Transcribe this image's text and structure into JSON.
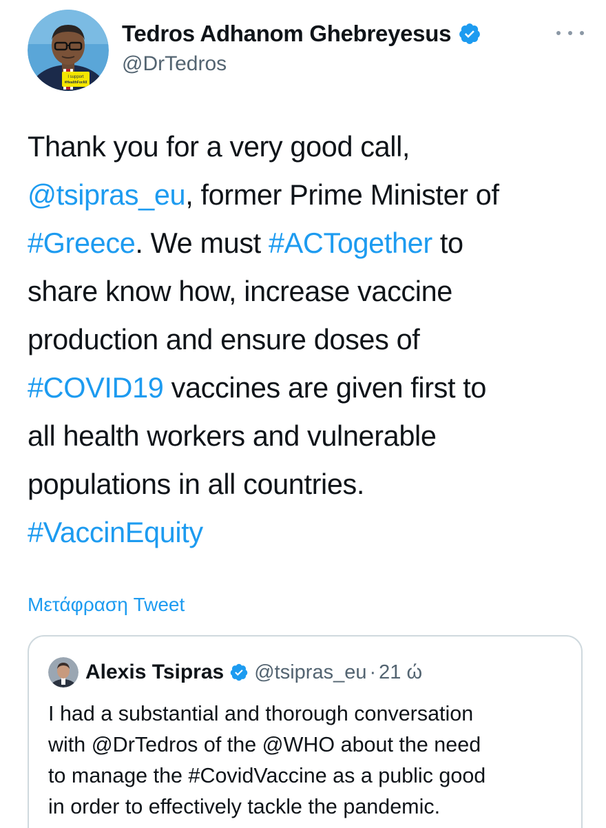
{
  "author": {
    "name": "Tedros Adhanom Ghebreyesus",
    "handle": "@DrTedros",
    "avatar_badge_line1": "I support",
    "avatar_badge_line2": "#HealthForAll"
  },
  "tweet": {
    "lines": [
      [
        {
          "text": "Thank you for a very good call,",
          "link": false
        }
      ],
      [
        {
          "text": "@tsipras_eu",
          "link": true
        },
        {
          "text": ", former Prime Minister of",
          "link": false
        }
      ],
      [
        {
          "text": "#Greece",
          "link": true
        },
        {
          "text": ". We must ",
          "link": false
        },
        {
          "text": "#ACTogether",
          "link": true
        },
        {
          "text": " to",
          "link": false
        }
      ],
      [
        {
          "text": "share know how, increase vaccine",
          "link": false
        }
      ],
      [
        {
          "text": "production and ensure doses of",
          "link": false
        }
      ],
      [
        {
          "text": "#COVID19",
          "link": true
        },
        {
          "text": " vaccines are given first to",
          "link": false
        }
      ],
      [
        {
          "text": "all health workers and vulnerable",
          "link": false
        }
      ],
      [
        {
          "text": "populations in all countries.",
          "link": false
        }
      ],
      [
        {
          "text": "#VaccinEquity",
          "link": true
        }
      ]
    ],
    "translate_label": "Μετάφραση Tweet"
  },
  "quoted_tweet": {
    "name": "Alexis Tsipras",
    "handle": "@tsipras_eu",
    "separator": "·",
    "time": "21 ώ",
    "lines": [
      "I had a substantial and thorough conversation",
      "with @DrTedros of the @WHO about the need",
      "to manage the #CovidVaccine as a public good",
      "in order to effectively tackle the pandemic."
    ]
  },
  "colors": {
    "link": "#1d9bf0",
    "verified": "#1d9bf0",
    "text": "#0f1419",
    "secondary": "#536471",
    "border": "#cfd9de"
  },
  "icons": {
    "verified": "verified-badge-icon",
    "more": "more-horizontal-icon"
  }
}
